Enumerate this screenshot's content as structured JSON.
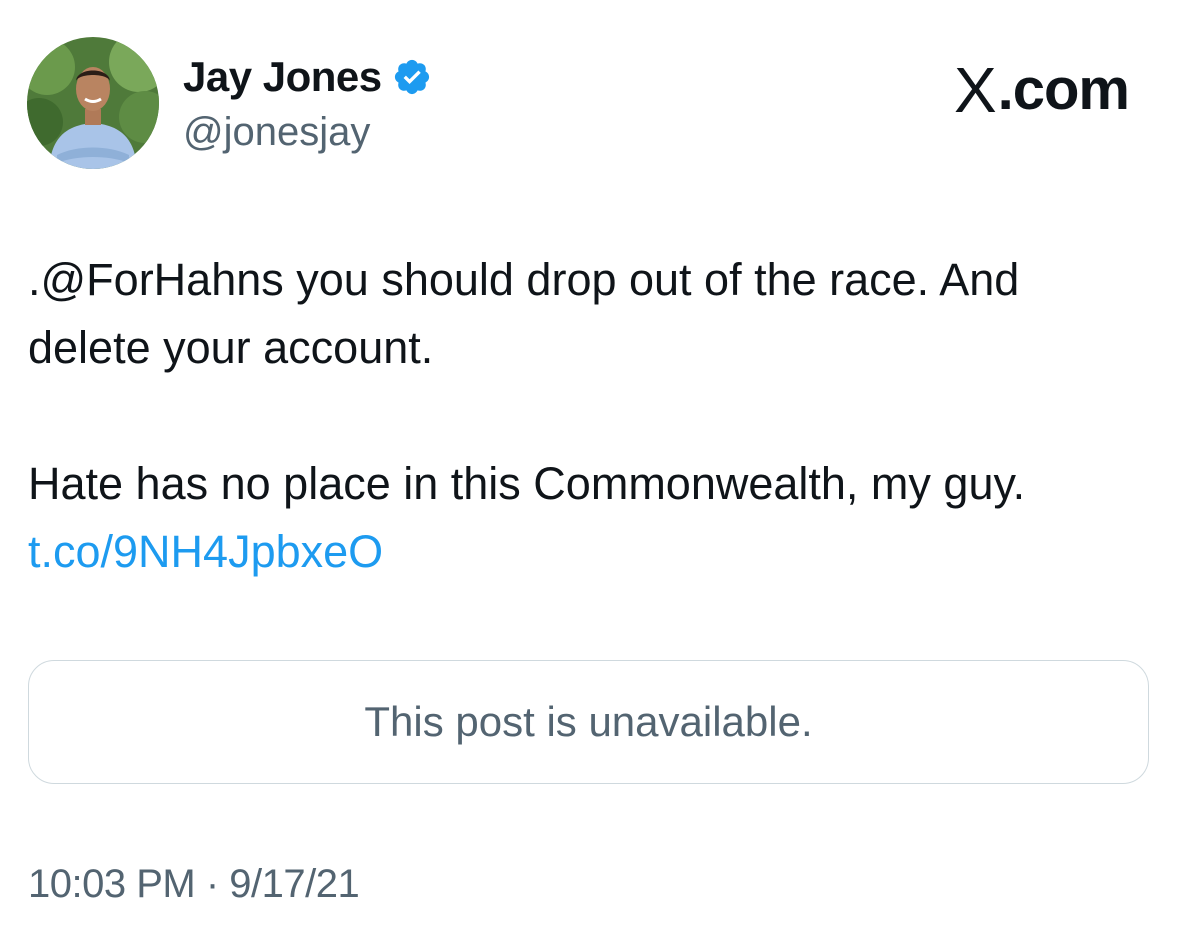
{
  "author": {
    "display_name": "Jay Jones",
    "handle": "@jonesjay",
    "verified_icon": "verified-badge-icon",
    "badge_color": "#1d9bf0"
  },
  "brand": {
    "logo": "X",
    "suffix": ".com"
  },
  "tweet": {
    "line1": ".@ForHahns you should drop out of the race. And delete your account.",
    "line2_text": "Hate has no place in this Commonwealth, my guy. ",
    "link": "t.co/9NH4JpbxeO",
    "link_color": "#1d9bf0"
  },
  "quoted_post": {
    "status": "This post is unavailable."
  },
  "meta": {
    "time": "10:03 PM",
    "separator": "·",
    "date": "9/17/21"
  }
}
